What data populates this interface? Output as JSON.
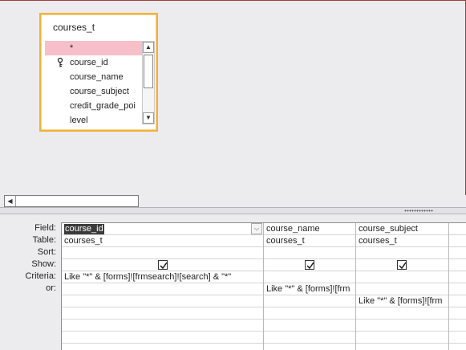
{
  "table": {
    "title": "courses_t",
    "fields": [
      "*",
      "course_id",
      "course_name",
      "course_subject",
      "credit_grade_poi",
      "level"
    ],
    "key_field_index": 1,
    "selected_field_index": 0
  },
  "grid": {
    "row_labels": [
      "Field:",
      "Table:",
      "Sort:",
      "Show:",
      "Criteria:",
      "or:"
    ],
    "columns": [
      {
        "field": "course_id",
        "table": "courses_t",
        "sort": "",
        "show": true,
        "criteria": "Like \"*\" & [forms]![frmsearch]![search] & \"*\"",
        "or": "",
        "or2": ""
      },
      {
        "field": "course_name",
        "table": "courses_t",
        "sort": "",
        "show": true,
        "criteria": "",
        "or": "Like \"*\" & [forms]![frm",
        "or2": ""
      },
      {
        "field": "course_subject",
        "table": "courses_t",
        "sort": "",
        "show": true,
        "criteria": "",
        "or": "",
        "or2": "Like \"*\" & [forms]![frm"
      }
    ]
  },
  "colors": {
    "table_border": "#f2b137",
    "selected_field_bg": "#f7bfc7",
    "pane_bg": "#ececef"
  }
}
